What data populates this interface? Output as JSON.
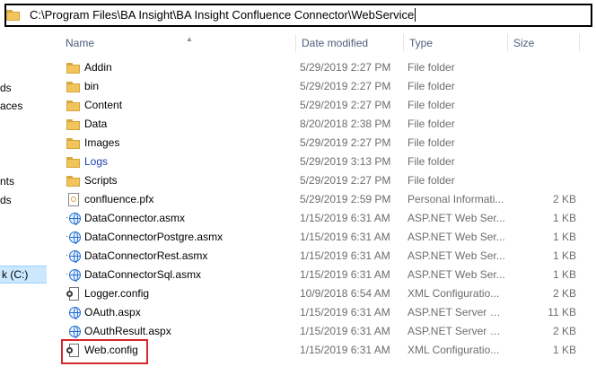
{
  "address": {
    "path": "C:\\Program Files\\BA Insight\\BA Insight Confluence Connector\\WebService"
  },
  "nav": {
    "items": [
      {
        "label": "ds"
      },
      {
        "label": "aces"
      },
      {
        "label": "nts"
      },
      {
        "label": "ds"
      },
      {
        "label": "k (C:)"
      }
    ]
  },
  "columns": {
    "name": "Name",
    "date": "Date modified",
    "type": "Type",
    "size": "Size"
  },
  "files": [
    {
      "name": "Addin",
      "date": "5/29/2019 2:27 PM",
      "type": "File folder",
      "size": "",
      "icon": "folder-icon"
    },
    {
      "name": "bin",
      "date": "5/29/2019 2:27 PM",
      "type": "File folder",
      "size": "",
      "icon": "folder-icon"
    },
    {
      "name": "Content",
      "date": "5/29/2019 2:27 PM",
      "type": "File folder",
      "size": "",
      "icon": "folder-icon"
    },
    {
      "name": "Data",
      "date": "8/20/2018 2:38 PM",
      "type": "File folder",
      "size": "",
      "icon": "folder-icon"
    },
    {
      "name": "Images",
      "date": "5/29/2019 2:27 PM",
      "type": "File folder",
      "size": "",
      "icon": "folder-icon"
    },
    {
      "name": "Logs",
      "date": "5/29/2019 3:13 PM",
      "type": "File folder",
      "size": "",
      "icon": "folder-icon",
      "color": "#1a3eb5"
    },
    {
      "name": "Scripts",
      "date": "5/29/2019 2:27 PM",
      "type": "File folder",
      "size": "",
      "icon": "folder-icon"
    },
    {
      "name": "confluence.pfx",
      "date": "5/29/2019 2:59 PM",
      "type": "Personal Informati...",
      "size": "2 KB",
      "icon": "certificate-icon"
    },
    {
      "name": "DataConnector.asmx",
      "date": "1/15/2019 6:31 AM",
      "type": "ASP.NET Web Ser...",
      "size": "1 KB",
      "icon": "web-service-icon"
    },
    {
      "name": "DataConnectorPostgre.asmx",
      "date": "1/15/2019 6:31 AM",
      "type": "ASP.NET Web Ser...",
      "size": "1 KB",
      "icon": "web-service-icon"
    },
    {
      "name": "DataConnectorRest.asmx",
      "date": "1/15/2019 6:31 AM",
      "type": "ASP.NET Web Ser...",
      "size": "1 KB",
      "icon": "web-service-icon"
    },
    {
      "name": "DataConnectorSql.asmx",
      "date": "1/15/2019 6:31 AM",
      "type": "ASP.NET Web Ser...",
      "size": "1 KB",
      "icon": "web-service-icon"
    },
    {
      "name": "Logger.config",
      "date": "10/9/2018 6:54 AM",
      "type": "XML Configuratio...",
      "size": "2 KB",
      "icon": "config-file-icon"
    },
    {
      "name": "OAuth.aspx",
      "date": "1/15/2019 6:31 AM",
      "type": "ASP.NET Server Pa...",
      "size": "11 KB",
      "icon": "web-page-icon"
    },
    {
      "name": "OAuthResult.aspx",
      "date": "1/15/2019 6:31 AM",
      "type": "ASP.NET Server Pa...",
      "size": "2 KB",
      "icon": "web-page-icon"
    },
    {
      "name": "Web.config",
      "date": "1/15/2019 6:31 AM",
      "type": "XML Configuratio...",
      "size": "1 KB",
      "icon": "config-file-icon",
      "highlighted": true
    }
  ],
  "colors": {
    "highlight": "#d9262c",
    "folder": "#f2c55c",
    "header_text": "#4c607a",
    "link_blue": "#1a3eb5",
    "selection": "#cce8ff"
  }
}
